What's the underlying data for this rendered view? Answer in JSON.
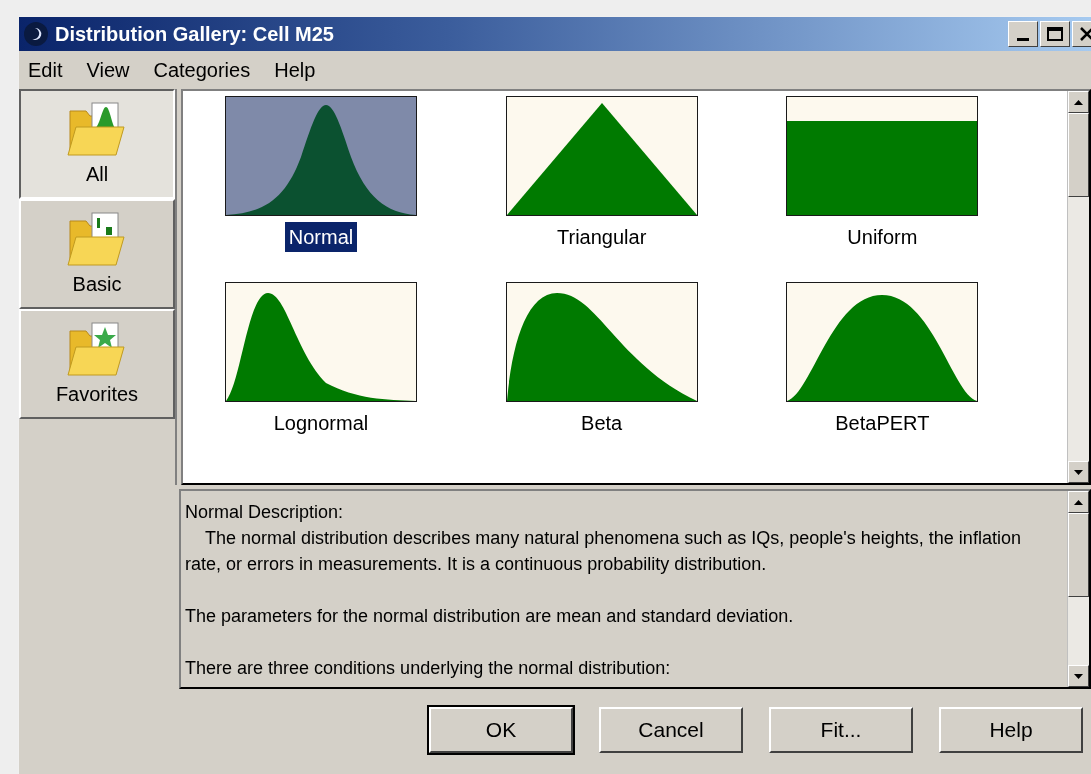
{
  "window": {
    "title": "Distribution Gallery: Cell M25"
  },
  "menu": [
    "Edit",
    "View",
    "Categories",
    "Help"
  ],
  "categories": [
    {
      "label": "All",
      "kind": "all",
      "selected": true
    },
    {
      "label": "Basic",
      "kind": "basic",
      "selected": false
    },
    {
      "label": "Favorites",
      "kind": "favorites",
      "selected": false
    }
  ],
  "distributions": [
    {
      "name": "Normal",
      "kind": "normal",
      "selected": true
    },
    {
      "name": "Triangular",
      "kind": "triangular",
      "selected": false
    },
    {
      "name": "Uniform",
      "kind": "uniform",
      "selected": false
    },
    {
      "name": "Lognormal",
      "kind": "lognormal",
      "selected": false
    },
    {
      "name": "Beta",
      "kind": "beta",
      "selected": false
    },
    {
      "name": "BetaPERT",
      "kind": "betapert",
      "selected": false
    }
  ],
  "description": {
    "heading": "Normal Description:",
    "paragraphs": [
      "    The normal distribution describes many natural phenomena such as IQs, people's heights, the inflation rate, or errors in measurements. It is a continuous probability distribution.",
      "The parameters for the normal distribution are mean and standard deviation.",
      "There are three conditions underlying the normal distribution:"
    ]
  },
  "buttons": [
    {
      "label": "OK",
      "default": true
    },
    {
      "label": "Cancel",
      "default": false
    },
    {
      "label": "Fit...",
      "default": false
    },
    {
      "label": "Help",
      "default": false
    }
  ]
}
